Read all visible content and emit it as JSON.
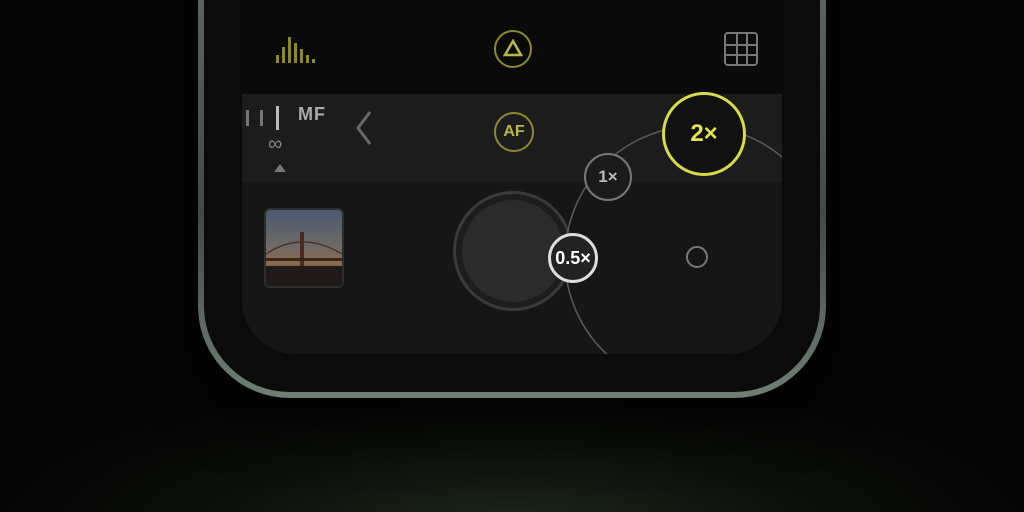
{
  "camera": {
    "focus_mode": "MF",
    "focus_distance": "∞",
    "af_label": "AF",
    "zoom_levels": [
      "1×",
      "0.5×",
      "2×"
    ],
    "selected_zoom": "2×"
  },
  "icons": {
    "histogram": "histogram-icon",
    "exposure": "triangle-exposure-icon",
    "grid": "grid-icon",
    "back": "chevron-left-icon"
  },
  "colors": {
    "accent": "#d9d94a",
    "background": "#121212"
  }
}
